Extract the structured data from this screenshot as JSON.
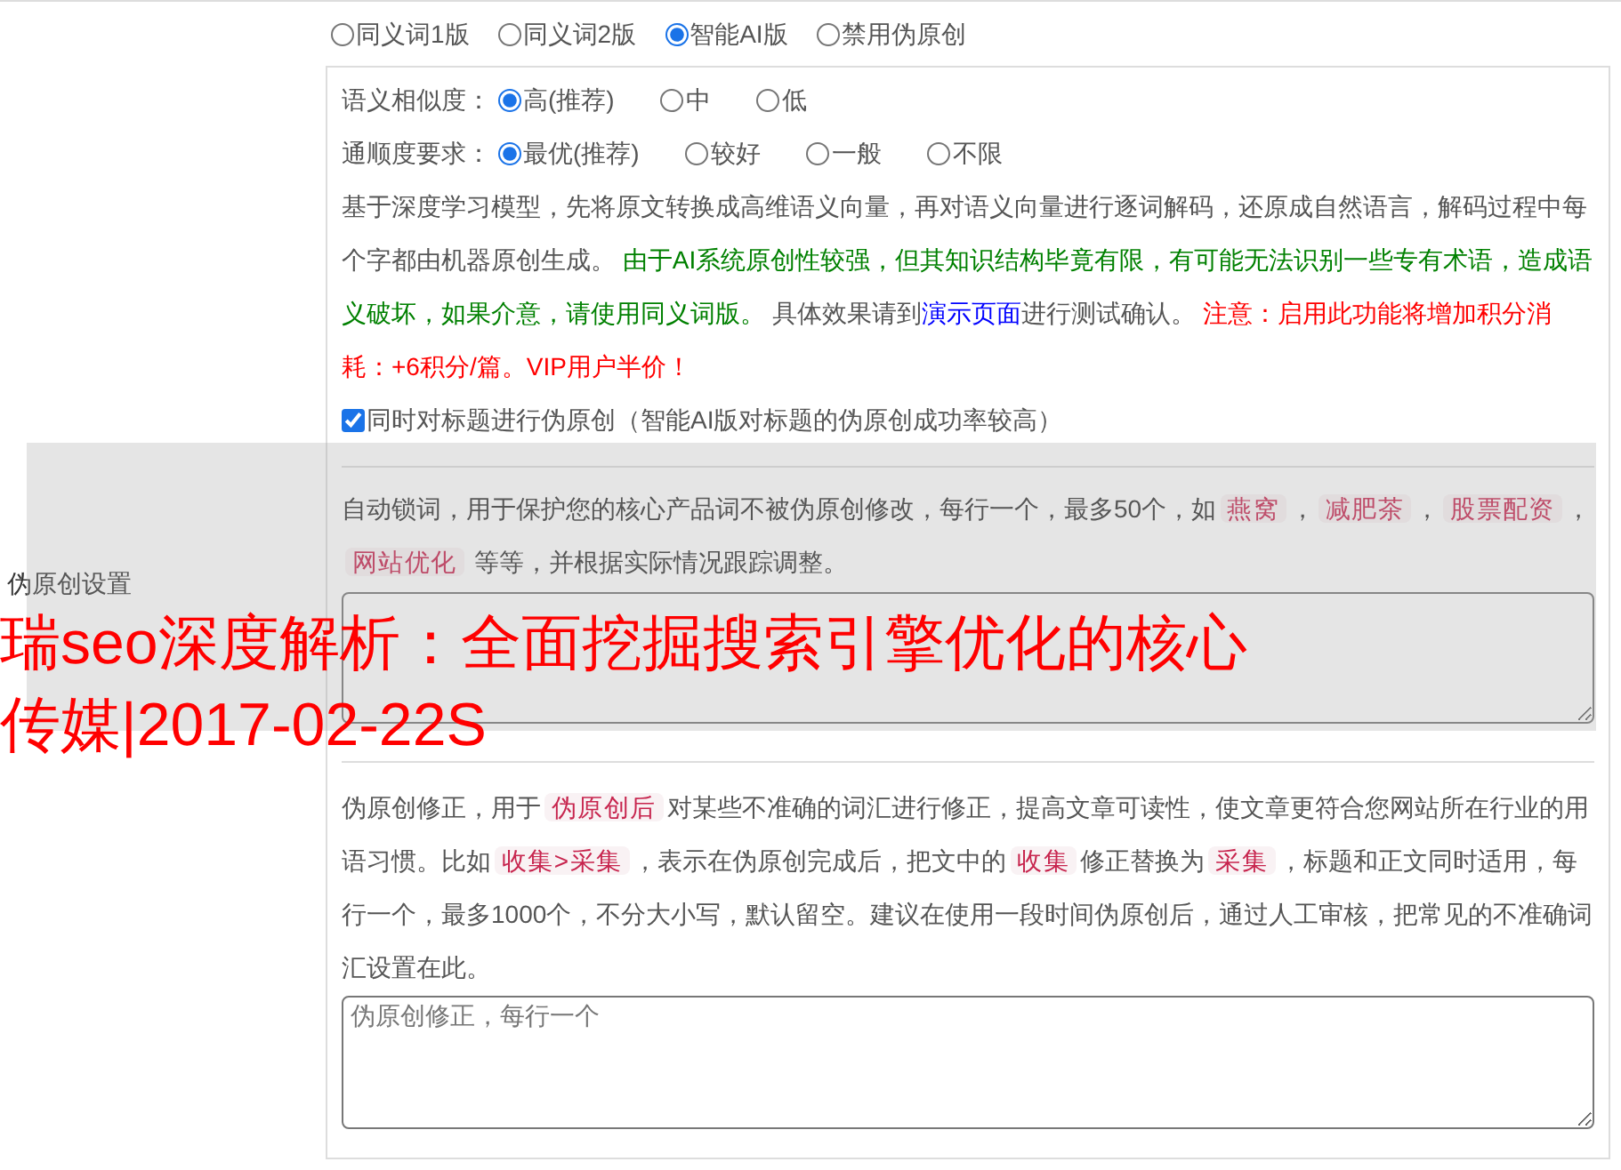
{
  "version_options": [
    {
      "label": "同义词1版",
      "selected": false
    },
    {
      "label": "同义词2版",
      "selected": false
    },
    {
      "label": "智能AI版",
      "selected": true
    },
    {
      "label": "禁用伪原创",
      "selected": false
    }
  ],
  "ai_settings": {
    "similarity": {
      "label": "语义相似度：",
      "options": [
        {
          "label": "高(推荐)",
          "selected": true
        },
        {
          "label": "中",
          "selected": false
        },
        {
          "label": "低",
          "selected": false
        }
      ]
    },
    "fluency": {
      "label": "通顺度要求：",
      "options": [
        {
          "label": "最优(推荐)",
          "selected": true
        },
        {
          "label": "较好",
          "selected": false
        },
        {
          "label": "一般",
          "selected": false
        },
        {
          "label": "不限",
          "selected": false
        }
      ]
    },
    "description": [
      {
        "kind": "plain",
        "text": "基于深度学习模型，先将原文转换成高维语义向量，再对语义向量进行逐词解码，还原成自然语言，解码过程中每个字都由机器原创生成。 "
      },
      {
        "kind": "note",
        "text": "由于AI系统原创性较强，但其知识结构毕竟有限，有可能无法识别一些专有术语，造成语义破坏，如果介意，请使用同义词版。"
      },
      {
        "kind": "plain",
        "text": " 具体效果请到"
      },
      {
        "kind": "link",
        "text": "演示页面"
      },
      {
        "kind": "plain",
        "text": "进行测试确认。 "
      },
      {
        "kind": "warning",
        "text": "注意：启用此功能将增加积分消耗：+6积分/篇。VIP用户半价！"
      }
    ],
    "title_option": {
      "label": "同时对标题进行伪原创（智能AI版对标题的伪原创成功率较高）",
      "checked": true
    }
  },
  "side_label": "伪原创设置",
  "lock_words": {
    "description": [
      {
        "kind": "plain",
        "text": "自动锁词，用于保护您的核心产品词不被伪原创修改，每行一个，最多50个，如"
      },
      {
        "kind": "code",
        "text": "燕窝"
      },
      {
        "kind": "plain",
        "text": "，"
      },
      {
        "kind": "code",
        "text": "减肥茶"
      },
      {
        "kind": "plain",
        "text": "，"
      },
      {
        "kind": "code",
        "text": "股票配资"
      },
      {
        "kind": "plain",
        "text": "，"
      },
      {
        "kind": "code",
        "text": "网站优化"
      },
      {
        "kind": "plain",
        "text": " 等等，并根据实际情况跟踪调整。"
      }
    ]
  },
  "correction": {
    "description": [
      {
        "kind": "plain",
        "text": "伪原创修正，用于"
      },
      {
        "kind": "code",
        "text": "伪原创后"
      },
      {
        "kind": "plain",
        "text": "对某些不准确的词汇进行修正，提高文章可读性，使文章更符合您网站所在行业的用语习惯。比如"
      },
      {
        "kind": "code",
        "text": "收集>采集"
      },
      {
        "kind": "plain",
        "text": "，表示在伪原创完成后，把文中的"
      },
      {
        "kind": "code",
        "text": "收集"
      },
      {
        "kind": "plain",
        "text": "修正替换为"
      },
      {
        "kind": "code",
        "text": "采集"
      },
      {
        "kind": "plain",
        "text": "，标题和正文同时适用，每行一个，最多1000个，不分大小写，默认留空。建议在使用一段时间伪原创后，通过人工审核，把常见的不准确词汇设置在此。"
      }
    ],
    "textarea": {
      "placeholder": "伪原创修正，每行一个"
    }
  },
  "overlay": {
    "lines": [
      "瑞seo深度解析：全面挖掘搜索引擎优化的核心",
      "传媒|2017-02-22S"
    ]
  }
}
